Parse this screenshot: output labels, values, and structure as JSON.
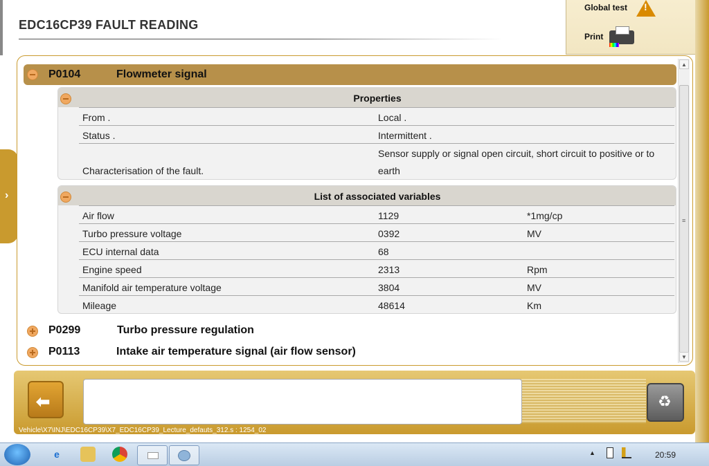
{
  "app": {
    "title": "EDC16CP39  FAULT READING"
  },
  "toolbar": {
    "global_test_label": "Global test",
    "print_label": "Print"
  },
  "faults": {
    "expanded": {
      "code": "P0104",
      "description": "Flowmeter signal"
    },
    "collapsed": [
      {
        "code": "P0299",
        "description": "Turbo pressure regulation"
      },
      {
        "code": "P0113",
        "description": "Intake air temperature signal (air flow sensor)"
      }
    ]
  },
  "properties": {
    "title": "Properties",
    "rows": [
      {
        "label": "From .",
        "value": "Local ."
      },
      {
        "label": "Status .",
        "value": "Intermittent ."
      },
      {
        "label": "Characterisation of the fault.",
        "value_line1": "Sensor supply or signal open circuit, short circuit to positive or to",
        "value_line2": "earth"
      }
    ]
  },
  "variables": {
    "title": "List of associated variables",
    "rows": [
      {
        "name": "Air flow",
        "value": "1129",
        "unit": "*1mg/cp"
      },
      {
        "name": "Turbo pressure voltage",
        "value": "0392",
        "unit": "MV"
      },
      {
        "name": "ECU internal data",
        "value": "68",
        "unit": ""
      },
      {
        "name": "Engine speed",
        "value": "2313",
        "unit": "Rpm"
      },
      {
        "name": "Manifold air temperature voltage",
        "value": "3804",
        "unit": "MV"
      },
      {
        "name": "Mileage",
        "value": "48614",
        "unit": "Km"
      }
    ]
  },
  "footer": {
    "path": "Vehicle\\X7\\INJ\\EDC16CP39\\X7_EDC16CP39_Lecture_defauts_312.s : 1254_02",
    "message": ""
  },
  "taskbar": {
    "clock": "20:59"
  },
  "colors": {
    "accent": "#c99a2e",
    "fault_header": "#b7904a",
    "section_header": "#d9d6cf"
  }
}
